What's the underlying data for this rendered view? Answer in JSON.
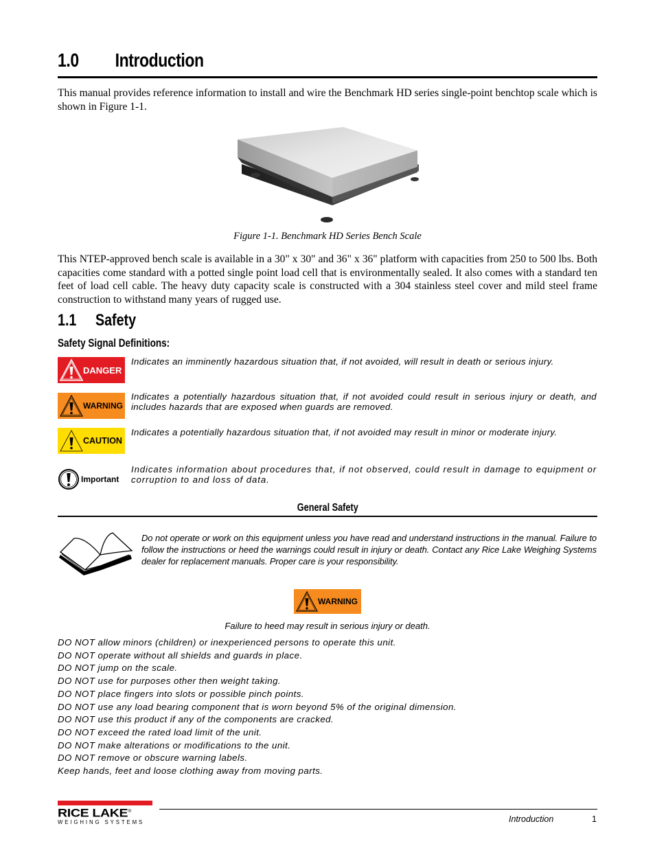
{
  "section": {
    "number": "1.0",
    "title": "Introduction",
    "intro_paragraph": "This manual provides reference information to install and wire the Benchmark HD series single-point benchtop scale which is shown in Figure 1-1.",
    "figure": {
      "image": "bench-scale-photo",
      "caption": "Figure 1-1. Benchmark HD Series Bench Scale"
    },
    "description_paragraph": "This NTEP-approved bench scale is available in a 30\" x 30\" and 36\" x 36\" platform with capacities from 250 to 500 lbs. Both capacities come standard with a potted single point load cell that is environmentally sealed. It also comes with a standard ten feet of load cell cable. The heavy duty capacity scale is constructed with a 304 stainless steel cover and mild steel frame construction to withstand many years of rugged use."
  },
  "safety": {
    "number": "1.1",
    "title": "Safety",
    "definitions_heading": "Safety Signal Definitions:",
    "signals": [
      {
        "label": "DANGER",
        "icon": "warning-triangle-icon",
        "color": "#e31b23",
        "text": "Indicates an imminently hazardous situation that, if not avoided, will result in death or serious injury."
      },
      {
        "label": "WARNING",
        "icon": "warning-triangle-icon",
        "color": "#f68b1f",
        "text": "Indicates a potentially hazardous situation that, if not avoided could result in serious injury or death, and includes hazards that are exposed when guards are removed."
      },
      {
        "label": "CAUTION",
        "icon": "warning-triangle-icon",
        "color": "#ffdd00",
        "text": "Indicates a potentially hazardous situation that, if not avoided may result in minor or moderate injury."
      },
      {
        "label": "Important",
        "icon": "exclamation-circle-icon",
        "color": "#ffffff",
        "text": "Indicates information about procedures that, if not observed, could result in damage to equipment or corruption to and loss of data."
      }
    ],
    "general": {
      "heading": "General Safety",
      "book_icon": "open-book-icon",
      "text": "Do not operate or work on this equipment unless you have read and understand instructions in the manual. Failure to follow the instructions or heed the warnings could result in injury or death. Contact any Rice Lake Weighing Systems dealer for replacement manuals. Proper care is your responsibility.",
      "warning_label": "WARNING",
      "warning_note": "Failure to heed may result in serious injury or death.",
      "rules": [
        "DO NOT allow minors (children) or inexperienced persons to operate this unit.",
        "DO NOT operate without all shields and guards in place.",
        "DO NOT jump on the scale.",
        "DO NOT use for purposes other then weight taking.",
        "DO NOT place fingers into slots or possible pinch points.",
        "DO NOT use any load bearing component that is worn beyond 5% of the original dimension.",
        "DO NOT use this product if any of the components are cracked.",
        "DO NOT exceed the rated load limit of the unit.",
        "DO NOT make alterations or modifications to the unit.",
        "DO NOT remove or obscure warning labels.",
        "Keep hands, feet and loose clothing away from moving parts."
      ]
    }
  },
  "footer": {
    "logo_name": "RICE LAKE",
    "logo_registered": "®",
    "logo_sub": "WEIGHING SYSTEMS",
    "brand_color": "#e31b23",
    "section_name": "Introduction",
    "page_number": "1"
  }
}
